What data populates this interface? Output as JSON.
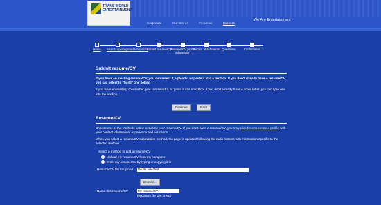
{
  "header": {
    "logo_text_line1": "TRANS WORLD",
    "logo_text_line2": "ENTERTAINMENT",
    "tagline": "We Are Entertainment",
    "nav": [
      "Corporate",
      "Our Stores",
      "Financial",
      "Careers"
    ],
    "active_nav": "Careers"
  },
  "steps": [
    {
      "label": "Home",
      "done": true
    },
    {
      "label": "Search openings",
      "done": true
    },
    {
      "label": "Search results",
      "done": true
    },
    {
      "label": "Submit resume/CV",
      "done": false
    },
    {
      "label": "Resume/CV profile information",
      "done": false
    },
    {
      "label": "Submit attachments",
      "done": false
    },
    {
      "label": "Questions",
      "done": false
    },
    {
      "label": "Confirmation",
      "done": false
    }
  ],
  "submit": {
    "title": "Submit resume/CV",
    "p1": "If you have an existing resume/CV, you can select it, upload it or paste it into a textbox. If you don't already have a resume/CV, you can select to \"build\" one below.",
    "p2": "If you have an existing cover letter, you can select it, or paste it into a textbox. If you don't already have a cover letter, you can type one into the textbox.",
    "continue_label": "Continue",
    "back_label": "Back"
  },
  "resume": {
    "title": "Resume/CV",
    "p1_before": "Choose one of the methods below to submit your resume/CV. If you don't have a resume/CV, you may ",
    "p1_link": "click here to create a profile",
    "p1_after": " with your contact information, experience and education.",
    "p2": "When you select a resume/CV submission method, the page is updated following the radio buttons with information specific to the selected method.",
    "method_label": "Select a method to add a resume/CV",
    "option1": "Upload my resume/CV from my computer",
    "option2": "Enter my resume/CV by typing or copying it in",
    "file_label": "Resume/CV file to upload",
    "file_value": "No file selected.",
    "browse_label": "Browse...",
    "name_label": "Name this resume/CV",
    "name_value": "My resume/CV",
    "max_size": "(Maximum file size: 3 MB)"
  }
}
